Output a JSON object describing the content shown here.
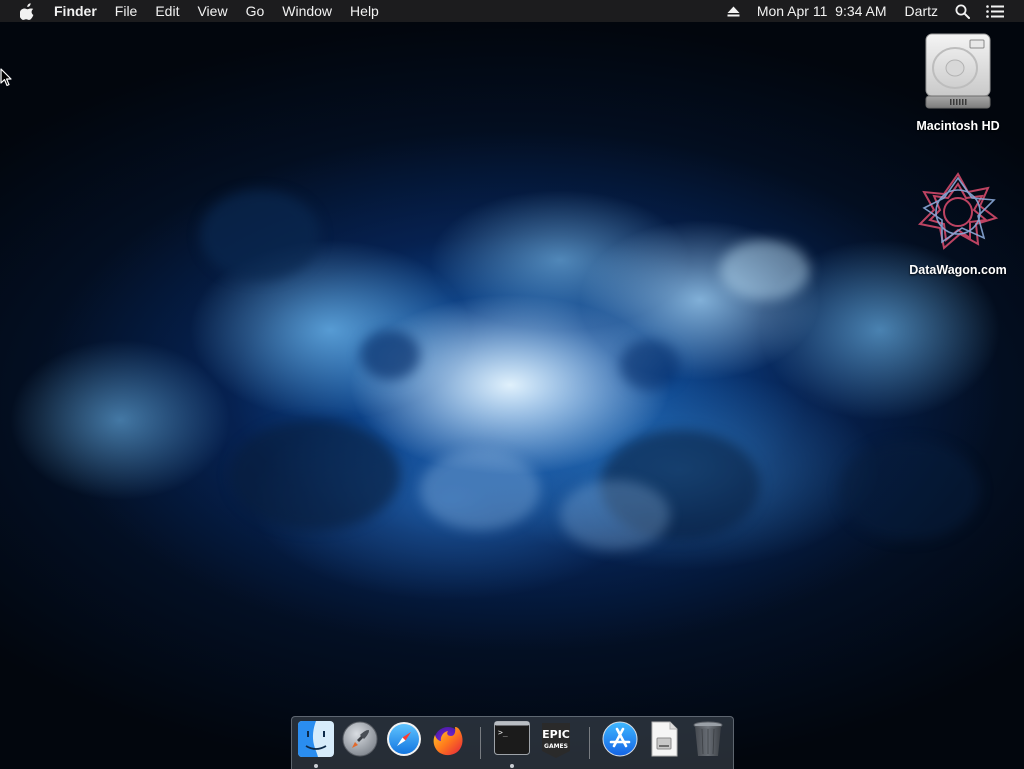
{
  "menubar": {
    "apple_icon": "apple-icon",
    "app_name": "Finder",
    "menus": [
      "File",
      "Edit",
      "View",
      "Go",
      "Window",
      "Help"
    ],
    "status": {
      "eject_icon": "eject-icon",
      "datetime": "Mon Apr 11  9:34 AM",
      "user": "Dartz",
      "search_icon": "spotlight-search-icon",
      "list_icon": "notification-center-icon"
    }
  },
  "desktop": {
    "icons": [
      {
        "label": "Macintosh HD",
        "icon": "hard-drive-icon"
      },
      {
        "label": "DataWagon.com",
        "icon": "star-pattern-icon"
      }
    ]
  },
  "dock": {
    "items": [
      {
        "name": "Finder",
        "icon": "finder-icon",
        "running": true
      },
      {
        "name": "Launchpad",
        "icon": "launchpad-rocket-icon",
        "running": false
      },
      {
        "name": "Safari",
        "icon": "safari-compass-icon",
        "running": false
      },
      {
        "name": "Firefox",
        "icon": "firefox-icon",
        "running": false
      },
      {
        "name": "Terminal",
        "icon": "terminal-icon",
        "running": true,
        "prompt": ">_"
      },
      {
        "name": "Epic Games Launcher",
        "icon": "epic-games-icon",
        "running": false,
        "logo_top": "EPIC",
        "logo_bottom": "GAMES"
      },
      {
        "name": "App Store",
        "icon": "app-store-icon",
        "running": false
      },
      {
        "name": "Documents",
        "icon": "document-stack-icon",
        "running": false
      },
      {
        "name": "Trash",
        "icon": "trash-icon",
        "running": false
      }
    ]
  },
  "colors": {
    "menubar_bg": "#1e1e20",
    "menubar_text": "#f2f2f2",
    "wallpaper_glow": "#1e8ce6",
    "finder_blue": "#2a8df0",
    "firefox_orange": "#ff7b1c"
  }
}
